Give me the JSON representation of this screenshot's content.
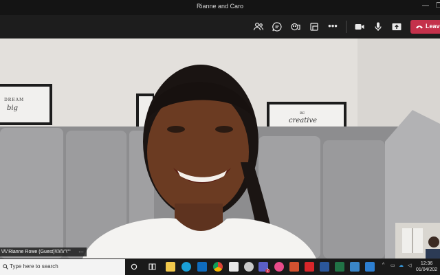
{
  "window": {
    "title": "Rianne and Caro",
    "minimize_glyph": "—",
    "restore_glyph": "❐"
  },
  "toolbar": {
    "icons": [
      "people-icon",
      "chat-icon",
      "reactions-icon",
      "share-tray-icon",
      "more-icon",
      "camera-icon",
      "microphone-icon",
      "share-screen-icon"
    ],
    "leave_label": "Leave",
    "leave_color": "#c4314b"
  },
  "video": {
    "participant_label": "\\\\\\\\\"Rianne Rowe (Guest)\\\\\\\\\\\\\\\"\\\"\"",
    "more_glyph": "···",
    "frames_text": [
      {
        "label": "DREAM",
        "script": "big"
      },
      {
        "label": "BE",
        "script": "creative"
      }
    ]
  },
  "taskbar": {
    "search_placeholder": "Type here to search",
    "teams_badge": "2",
    "pinned_apps": [
      "start-icon",
      "search-icon",
      "cortana-icon",
      "task-view-icon",
      "file-explorer-icon",
      "edge-icon",
      "outlook-icon",
      "chrome-icon",
      "notepad-icon",
      "snipping-icon",
      "teams-icon",
      "photos-icon",
      "powerpoint-icon",
      "acrobat-icon",
      "word-icon",
      "excel-icon",
      "remote-desktop-icon",
      "media-icon"
    ],
    "time": "12:36",
    "date": "01/04/202"
  }
}
